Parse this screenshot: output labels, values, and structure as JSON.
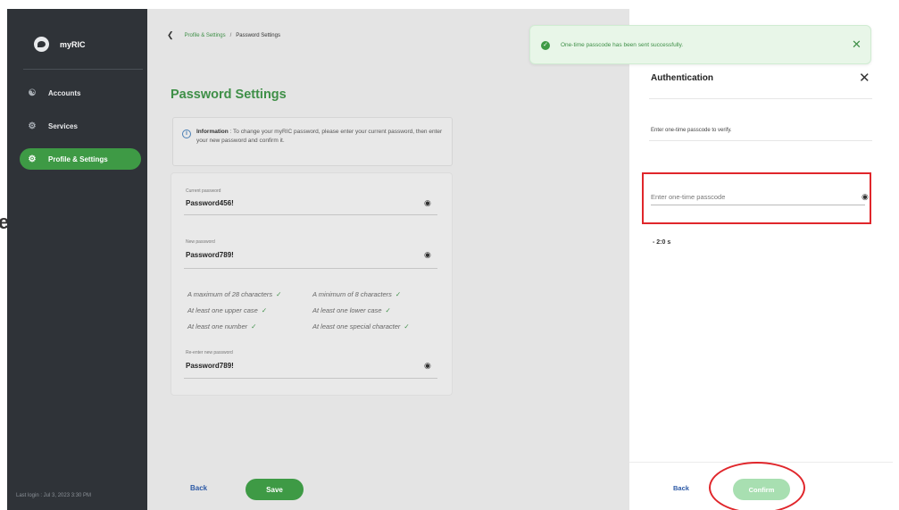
{
  "edge": {
    "text": "e"
  },
  "sidebar": {
    "app_name": "myRIC",
    "items": [
      {
        "label": "Accounts",
        "icon": "accounts-icon"
      },
      {
        "label": "Services",
        "icon": "services-icon"
      },
      {
        "label": "Profile & Settings",
        "icon": "gear-icon",
        "active": true
      }
    ],
    "last_login": "Last login : Jul 3, 2023 3:30 PM"
  },
  "breadcrumb": {
    "parent": "Profile & Settings",
    "separator": "/",
    "current": "Password Settings"
  },
  "main": {
    "title": "Password Settings",
    "info_label": "Information",
    "info_text": " : To change your myRIC password, please enter your current password, then enter your new password and confirm it.",
    "fields": {
      "current_label": "Current password",
      "current_value": "Password456!",
      "new_label": "New password",
      "new_value": "Password789!",
      "reenter_label": "Re-enter new password",
      "reenter_value": "Password789!"
    },
    "rules": [
      "A maximum of 28 characters",
      "A minimum of 8 characters",
      "At least one upper case",
      "At least one lower case",
      "At least one number",
      "At least one special character"
    ],
    "back_label": "Back",
    "save_label": "Save"
  },
  "toast": {
    "message": "One-time passcode has been sent successfully."
  },
  "panel": {
    "title": "Authentication",
    "description": "Enter one-time passcode to verify.",
    "otp_placeholder": "Enter one-time passcode",
    "otp_value": "",
    "timer": "- 2:0 s",
    "back_label": "Back",
    "confirm_label": "Confirm"
  },
  "colors": {
    "accent": "#3e9a45",
    "highlight": "#e0262b",
    "link": "#2d5aa6"
  }
}
